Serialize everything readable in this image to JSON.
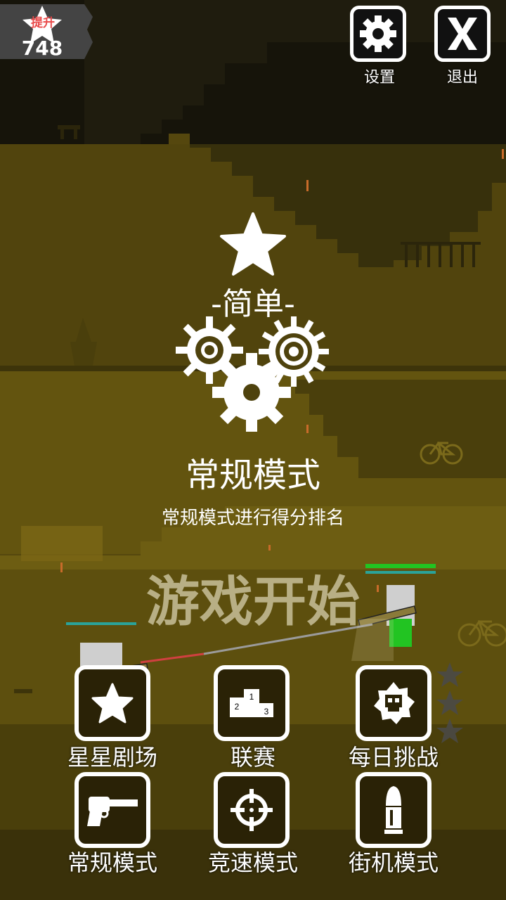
{
  "rank": {
    "badge_text": "提升",
    "score": "748"
  },
  "top_buttons": {
    "settings_label": "设置",
    "exit_label": "退出"
  },
  "mode": {
    "difficulty": "-简单-",
    "title": "常规模式",
    "description": "常规模式进行得分排名",
    "start": "游戏开始"
  },
  "menu": [
    {
      "label": "星星剧场",
      "icon": "star-icon"
    },
    {
      "label": "联赛",
      "icon": "podium-icon"
    },
    {
      "label": "每日挑战",
      "icon": "skull-badge-icon"
    },
    {
      "label": "常规模式",
      "icon": "revolver-icon"
    },
    {
      "label": "竞速模式",
      "icon": "crosshair-icon"
    },
    {
      "label": "街机模式",
      "icon": "bullet-icon"
    }
  ],
  "podium_numbers": [
    "1",
    "2",
    "3"
  ],
  "colors": {
    "ground": "#5a4c10",
    "health": "#22c422",
    "shield": "#2aa39a",
    "badge_up": "#e94a4a"
  }
}
